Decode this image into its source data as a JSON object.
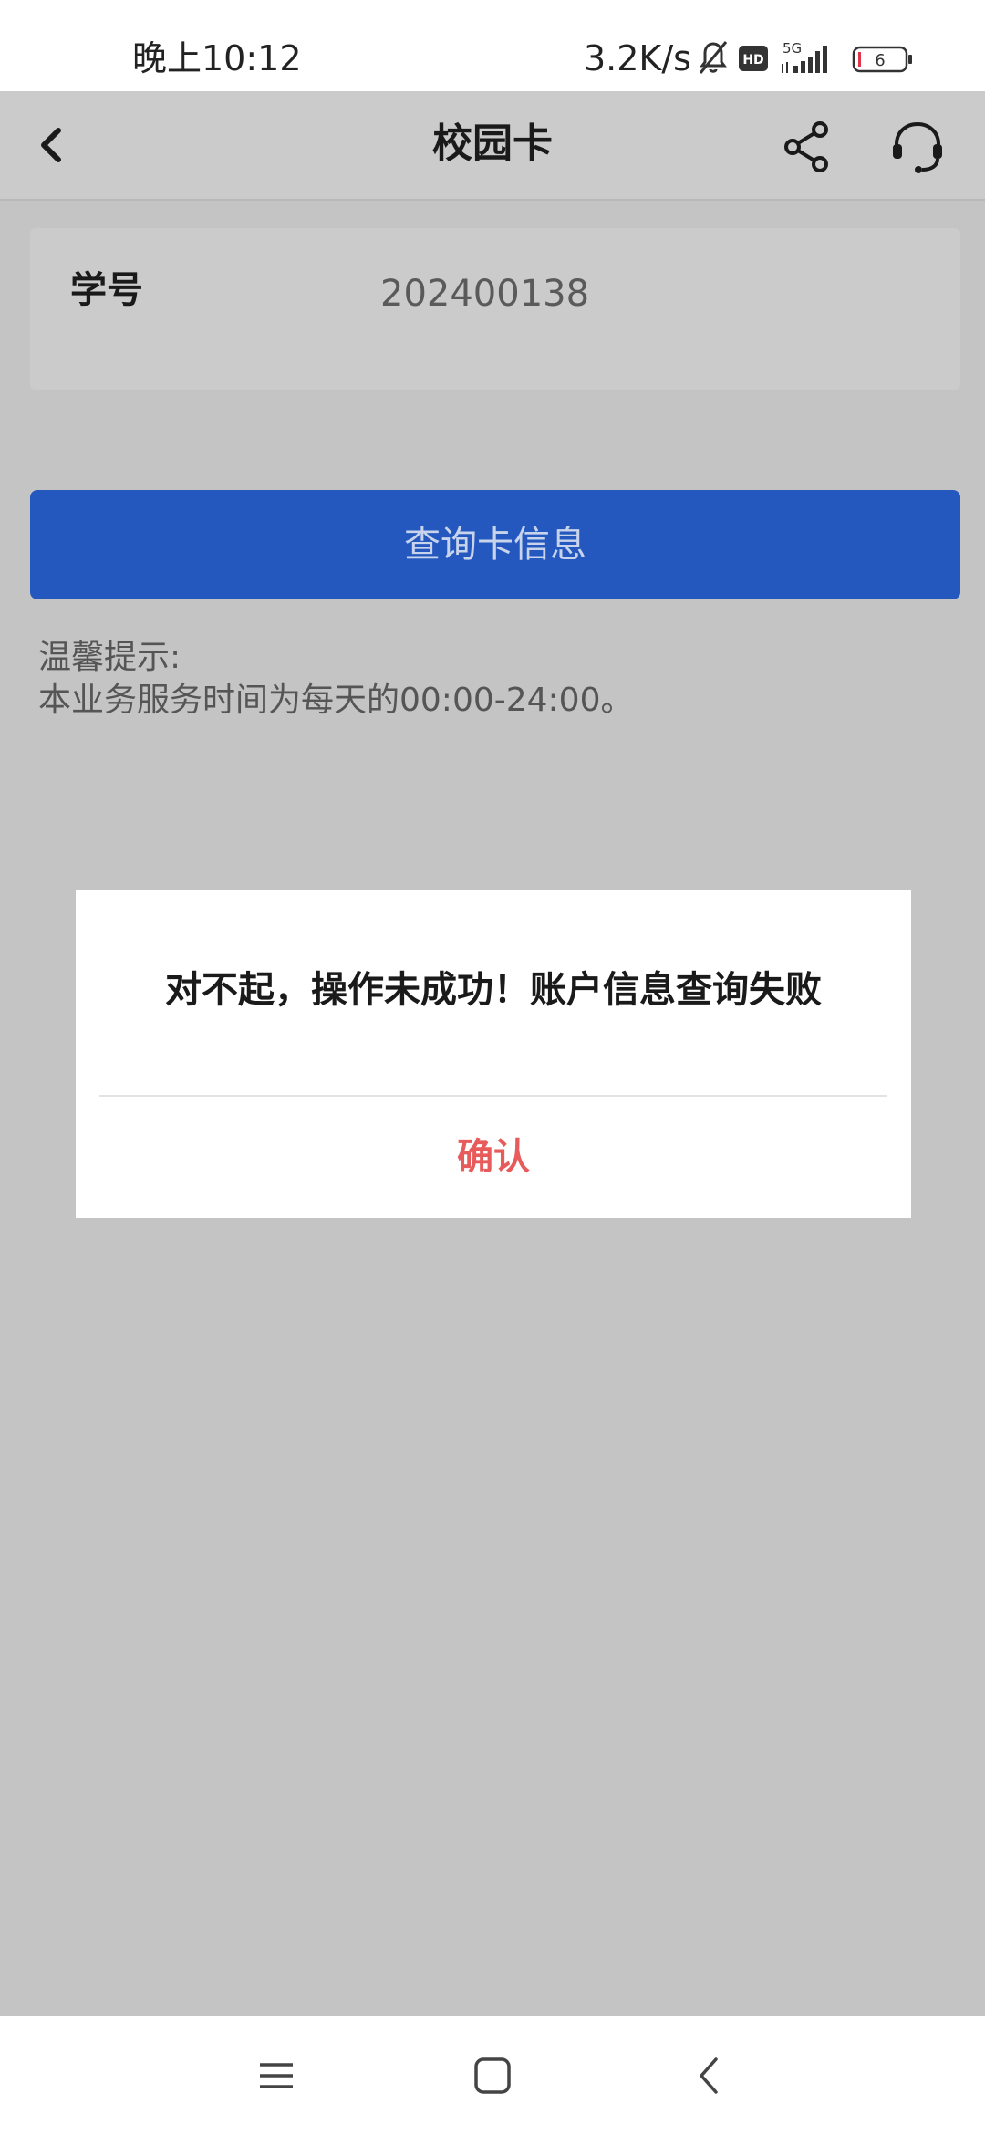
{
  "status_bar": {
    "time": "晚上10:12",
    "net_speed": "3.2K/s",
    "hd_label": "HD",
    "network_label": "5G",
    "battery_level": "6",
    "icons": [
      "mute-bell-icon",
      "hd-icon",
      "signal-5g-icon",
      "battery-icon"
    ]
  },
  "header": {
    "title": "校园卡",
    "icons": [
      "back-arrow-icon",
      "share-icon",
      "customer-service-icon"
    ]
  },
  "form": {
    "id_label": "学号",
    "id_value": "202400138"
  },
  "query_button": {
    "label": "查询卡信息"
  },
  "tips": {
    "title": "温馨提示:",
    "text": "本业务服务时间为每天的00:00-24:00。"
  },
  "dialog": {
    "message": "对不起，操作未成功！账户信息查询失败",
    "confirm_label": "确认"
  },
  "nav_bar": {
    "icons": [
      "menu-icon",
      "home-icon",
      "back-icon"
    ]
  },
  "colors": {
    "primary_button": "#2458bf",
    "confirm_text": "#e85b5b",
    "overlay_background": "#c4c4c4"
  }
}
